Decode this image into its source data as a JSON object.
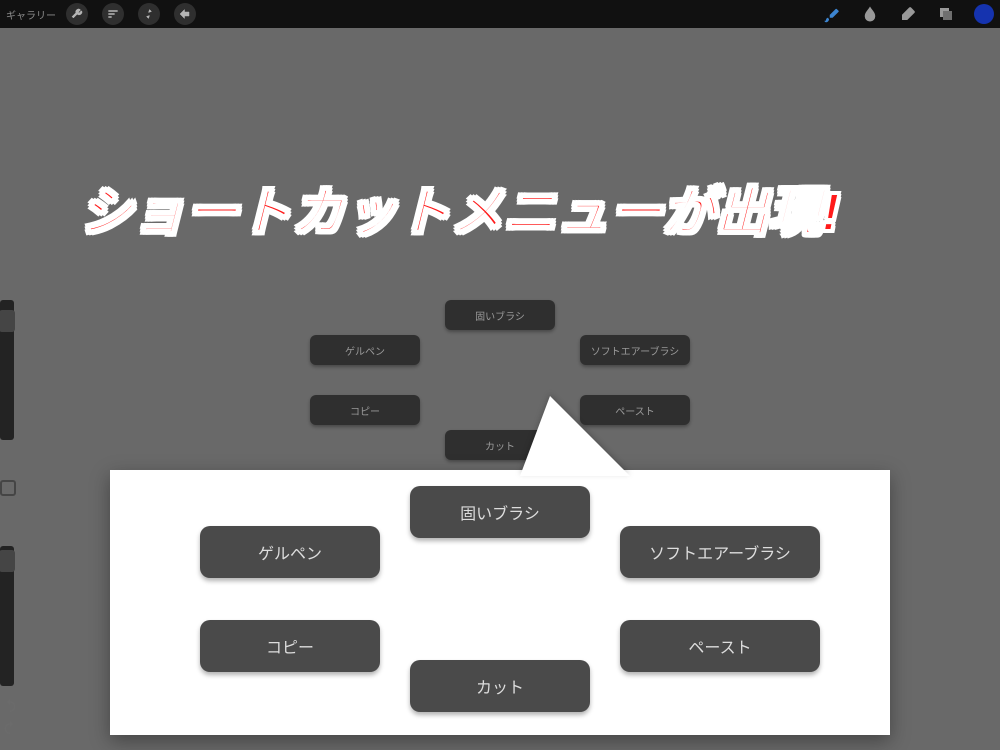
{
  "toolbar": {
    "gallery_label": "ギャラリー"
  },
  "shortcut_menu": {
    "top": "固いブラシ",
    "left_upper": "ゲルペン",
    "right_upper": "ソフトエアーブラシ",
    "left_lower": "コピー",
    "right_lower": "ペースト",
    "bottom": "カット"
  },
  "annotation": {
    "headline": "ショートカットメニューが出現!"
  },
  "colors": {
    "active_color": "#1a3fd6"
  }
}
